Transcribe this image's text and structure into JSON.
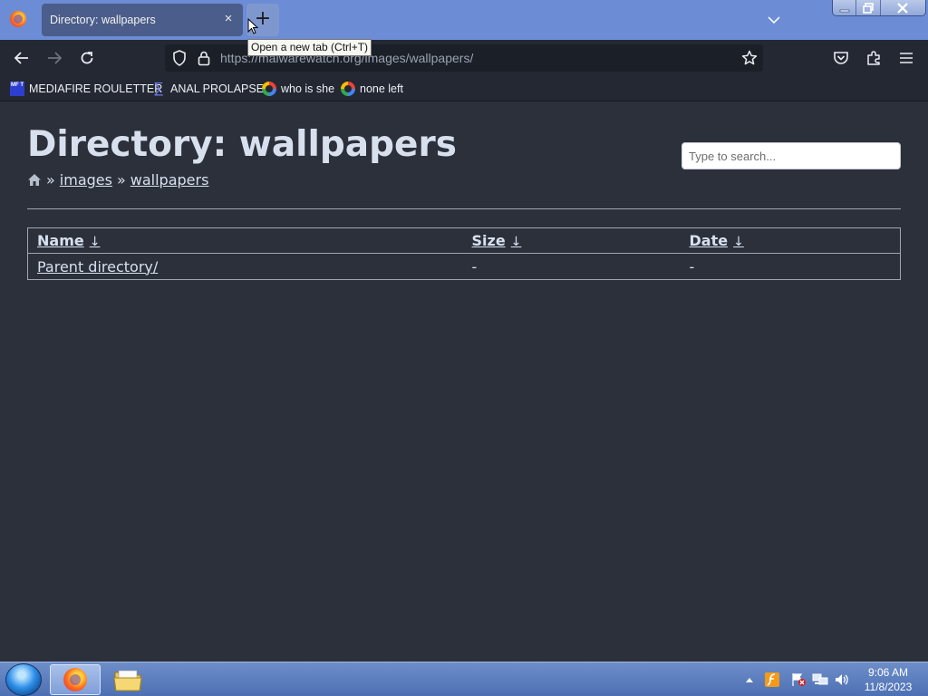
{
  "browser": {
    "tab": {
      "title": "Directory: wallpapers",
      "close_icon": "×",
      "new_tab_icon": "+"
    },
    "tooltip": "Open a new tab (Ctrl+T)",
    "address": "https://malwarewatch.org/images/wallpapers/",
    "bookmarks": [
      {
        "label": "MEDIAFIRE ROULETTER",
        "icon": "mft-favicon",
        "icon_text": "MF T"
      },
      {
        "label": "ANAL PROLAPSE",
        "icon": "sigma-favicon",
        "icon_text": "∑"
      },
      {
        "label": "who is she",
        "icon": "google-favicon"
      },
      {
        "label": "none left",
        "icon": "google-favicon"
      }
    ]
  },
  "page": {
    "title": "Directory: wallpapers",
    "search_placeholder": "Type to search...",
    "breadcrumb": {
      "sep": "»",
      "items": [
        "images",
        "wallpapers"
      ]
    },
    "table": {
      "headers": {
        "name": "Name",
        "size": "Size",
        "date": "Date",
        "sort_arrow": "↓"
      },
      "rows": [
        {
          "name": "Parent directory/",
          "size": "-",
          "date": "-"
        }
      ]
    }
  },
  "taskbar": {
    "time": "9:06 AM",
    "date": "11/8/2023",
    "tray_icons": [
      "show-hidden-icons",
      "flash-icon",
      "action-center-icon",
      "network-icon",
      "volume-icon"
    ]
  },
  "colors": {
    "page_bg": "#2b303b",
    "text": "#d8e0ee",
    "titlebar": "#6c8dd5",
    "toolbar": "#232833"
  }
}
